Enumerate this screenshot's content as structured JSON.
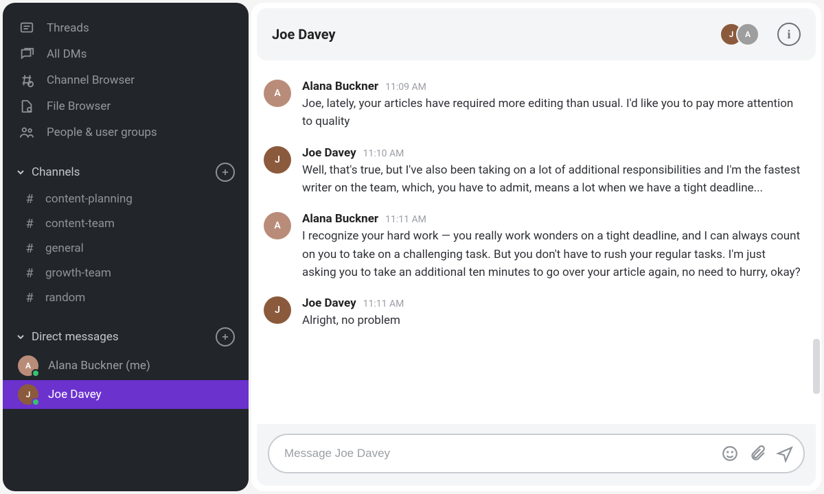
{
  "sidebar": {
    "nav": [
      {
        "id": "threads",
        "label": "Threads",
        "icon": "threads-icon"
      },
      {
        "id": "all-dms",
        "label": "All DMs",
        "icon": "all-dms-icon"
      },
      {
        "id": "channel-browser",
        "label": "Channel Browser",
        "icon": "channel-browser-icon"
      },
      {
        "id": "file-browser",
        "label": "File Browser",
        "icon": "file-browser-icon"
      },
      {
        "id": "people",
        "label": "People & user groups",
        "icon": "people-icon"
      }
    ],
    "channels_header": "Channels",
    "channels": [
      {
        "name": "content-planning"
      },
      {
        "name": "content-team"
      },
      {
        "name": "general"
      },
      {
        "name": "growth-team"
      },
      {
        "name": "random"
      }
    ],
    "dms_header": "Direct messages",
    "dms": [
      {
        "name": "Alana Buckner (me)",
        "active": false,
        "presence": "online",
        "avatar_bg": "#b98c7a",
        "initials": "A"
      },
      {
        "name": "Joe Davey",
        "active": true,
        "presence": "online",
        "avatar_bg": "#8b5a3c",
        "initials": "J"
      }
    ]
  },
  "header": {
    "title": "Joe Davey",
    "participants": [
      {
        "initials": "J",
        "bg": "#8b5a3c"
      },
      {
        "initials": "A",
        "bg": "#9e9e9e"
      }
    ]
  },
  "messages": [
    {
      "user": "Alana Buckner",
      "time": "11:09 AM",
      "avatar_bg": "#b98c7a",
      "initials": "A",
      "text": "Joe, lately, your articles have required more editing than usual. I'd like you to pay more attention to quality"
    },
    {
      "user": "Joe Davey",
      "time": "11:10 AM",
      "avatar_bg": "#8b5a3c",
      "initials": "J",
      "text": "Well, that's true, but I've also been taking on a lot of additional responsibilities and I'm the fastest writer on the team, which, you have to admit, means a lot when we have a tight deadline..."
    },
    {
      "user": "Alana Buckner",
      "time": "11:11 AM",
      "avatar_bg": "#b98c7a",
      "initials": "A",
      "text": "I recognize your hard work — you really work wonders on a tight deadline, and I can always count on you to take on a challenging task. But you don't have to rush your regular tasks. I'm just asking you to take an additional ten minutes to go over your article again, no need to hurry, okay?"
    },
    {
      "user": "Joe Davey",
      "time": "11:11 AM",
      "avatar_bg": "#8b5a3c",
      "initials": "J",
      "text": "Alright, no problem"
    }
  ],
  "composer": {
    "placeholder": "Message Joe Davey"
  }
}
